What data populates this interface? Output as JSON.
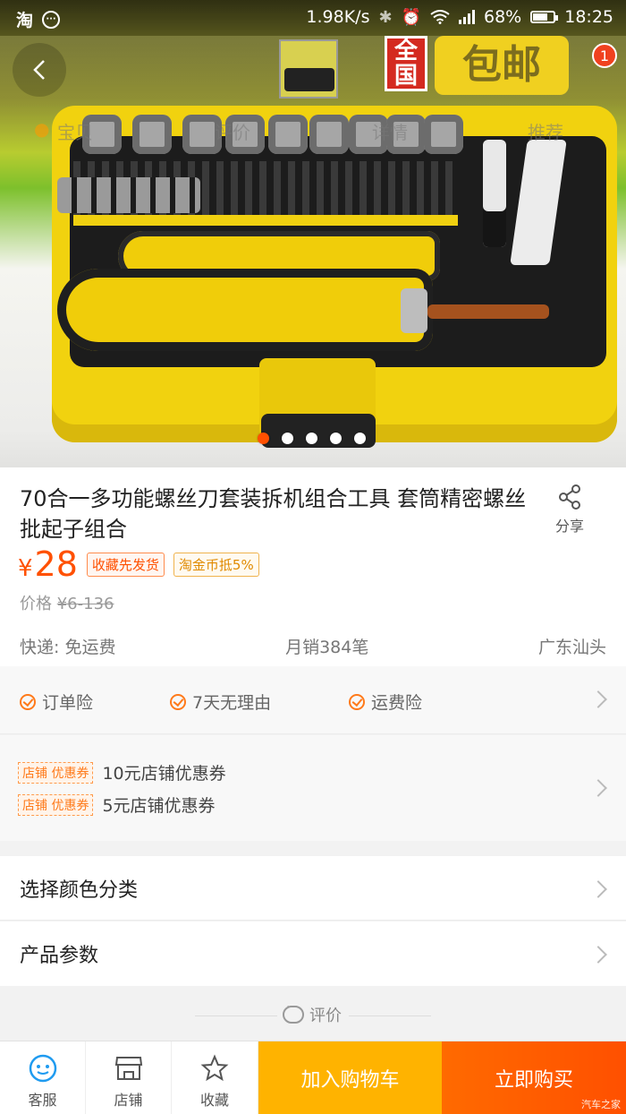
{
  "status_bar": {
    "carrier_icon": "淘",
    "network_speed": "1.98K/s",
    "battery": "68%",
    "time": "18:25"
  },
  "header": {
    "cart_badge_count": "1",
    "overlay_tabs": [
      "宝贝",
      "评价",
      "详情",
      "推荐"
    ],
    "promo_text_1": "全国",
    "promo_text_2": "包邮"
  },
  "carousel": {
    "total": 5,
    "active_index": 0
  },
  "product": {
    "title": "70合一多功能螺丝刀套装拆机组合工具 套筒精密螺丝批起子组合",
    "share_label": "分享",
    "currency": "¥",
    "price": "28",
    "tags": [
      "收藏先发货",
      "淘金币抵5%"
    ],
    "original_price_label": "价格",
    "original_price": "¥6-136",
    "shipping": "快递: 免运费",
    "monthly_sales": "月销384笔",
    "location": "广东汕头"
  },
  "services": [
    "订单险",
    "7天无理由",
    "运费险"
  ],
  "coupons": [
    {
      "tag": "店铺 优惠券",
      "text": "10元店铺优惠券"
    },
    {
      "tag": "店铺 优惠券",
      "text": "5元店铺优惠券"
    }
  ],
  "options": {
    "select_color": "选择颜色分类",
    "product_params": "产品参数"
  },
  "review_section_label": "评价",
  "bottom_bar": {
    "customer_service": "客服",
    "shop": "店铺",
    "favorite": "收藏",
    "add_to_cart": "加入购物车",
    "buy_now": "立即购买",
    "watermark": "汽车之家"
  },
  "colors": {
    "accent": "#ff5000",
    "cart_button": "#ffb300",
    "buy_button": "#ff5000"
  }
}
